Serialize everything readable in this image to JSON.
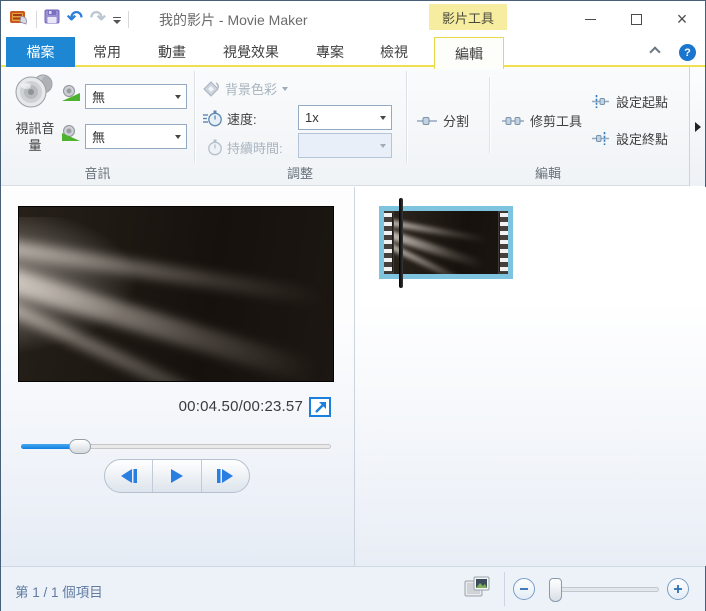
{
  "window": {
    "title": "我的影片 - Movie Maker",
    "context_tool_label": "影片工具"
  },
  "tabs": {
    "file": "檔案",
    "home": "常用",
    "animations": "動畫",
    "visual_effects": "視覺效果",
    "project": "專案",
    "view": "檢視",
    "edit": "編輯"
  },
  "ribbon": {
    "audio_group": {
      "label": "音訊",
      "video_volume": "視訊音量",
      "fade_in_value": "無",
      "fade_out_value": "無"
    },
    "adjust_group": {
      "label": "調整",
      "background_color": "背景色彩",
      "speed_label": "速度:",
      "speed_value": "1x",
      "duration_label": "持續時間:",
      "duration_value": ""
    },
    "edit_group": {
      "label": "編輯",
      "split": "分割",
      "trim_tool": "修剪工具",
      "set_start": "設定起點",
      "set_end": "設定終點"
    }
  },
  "preview": {
    "timecode": "00:04.50/00:23.57",
    "progress_percent": 19
  },
  "statusbar": {
    "items": "第 1 / 1 個項目",
    "zoom_slider_percent": 3
  },
  "colors": {
    "accent_blue": "#1d87d4",
    "contextual_yellow": "#f7eda0",
    "selection_cyan": "#7fc4df",
    "player_blue": "#2a7de1"
  }
}
